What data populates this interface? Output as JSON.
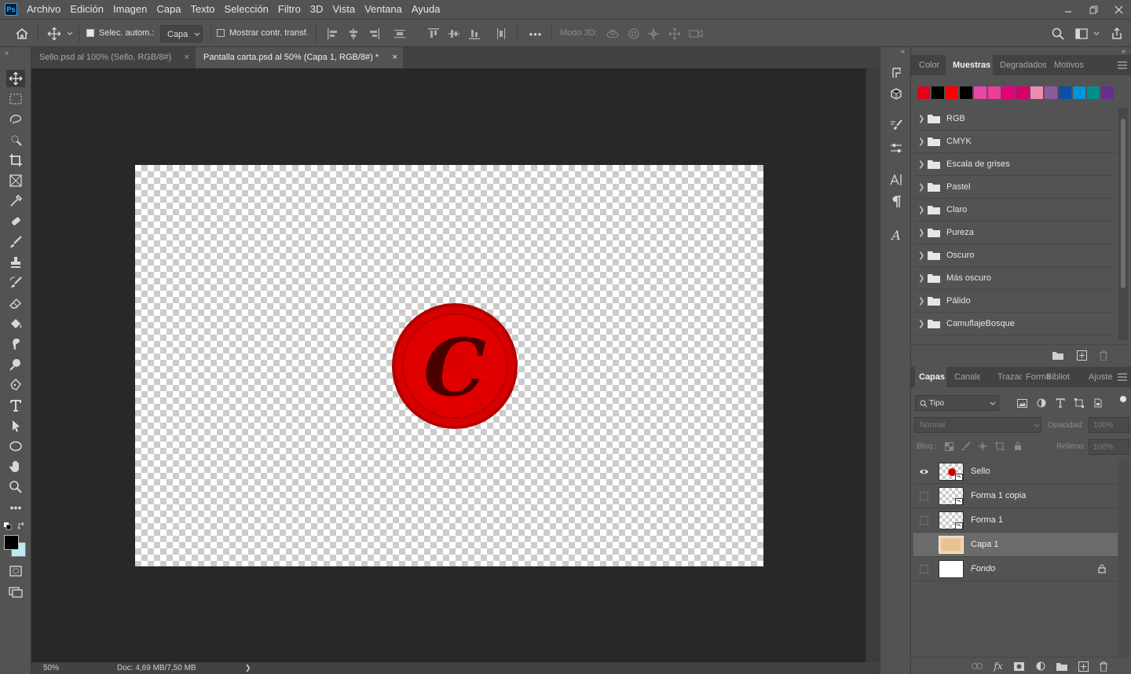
{
  "app": {
    "logo": "Ps"
  },
  "menu": [
    "Archivo",
    "Edición",
    "Imagen",
    "Capa",
    "Texto",
    "Selección",
    "Filtro",
    "3D",
    "Vista",
    "Ventana",
    "Ayuda"
  ],
  "window_controls": [
    "minimize-icon",
    "restore-icon",
    "close-icon"
  ],
  "options": {
    "auto_select_label": "Selec. autom.:",
    "auto_select_checked": true,
    "target_value": "Capa",
    "show_transform_label": "Mostrar contr. transf.",
    "show_transform_checked": false,
    "mode3d_label": "Modo 3D:",
    "more_label": "•••"
  },
  "tabs": [
    {
      "label": "Sello.psd al 100% (Sello, RGB/8#)",
      "active": false
    },
    {
      "label": "Pantalla carta.psd al 50% (Capa 1, RGB/8#) *",
      "active": true
    }
  ],
  "tab_close_glyph": "×",
  "status": {
    "zoom": "50%",
    "doc": "Doc: 4,69 MB/7,50 MB",
    "arrow": "❯"
  },
  "tools": [
    "move-tool-icon",
    "marquee-tool-icon",
    "lasso-tool-icon",
    "quick-select-tool-icon",
    "crop-tool-icon",
    "frame-tool-icon",
    "eyedropper-tool-icon",
    "healing-brush-tool-icon",
    "brush-tool-icon",
    "stamp-tool-icon",
    "history-brush-tool-icon",
    "eraser-tool-icon",
    "paint-bucket-tool-icon",
    "smudge-tool-icon",
    "dodge-tool-icon",
    "pen-tool-icon",
    "type-tool-icon",
    "path-select-tool-icon",
    "ellipse-tool-icon",
    "hand-tool-icon",
    "zoom-tool-icon",
    "more-tools-icon"
  ],
  "colors": {
    "foreground": "#000000",
    "background": "#bfe7ee"
  },
  "canvas": {
    "seal_letter": "C",
    "seal_color": "#d40000"
  },
  "swatch_panel": {
    "tabs": [
      "Color",
      "Muestras",
      "Degradados",
      "Motivos"
    ],
    "active_tab": "Muestras",
    "recent_swatches": [
      "#e5001c",
      "#000000",
      "#ff0000",
      "#000000",
      "#e946a9",
      "#ee3d98",
      "#e6007e",
      "#d5006b",
      "#ee8bb3",
      "#8c5a9e",
      "#0b4ea2",
      "#0094d9",
      "#008e8d",
      "#6b2c91"
    ],
    "groups": [
      "RGB",
      "CMYK",
      "Escala de grises",
      "Pastel",
      "Claro",
      "Pureza",
      "Oscuro",
      "Más oscuro",
      "Pálido",
      "CamuflajeBosque"
    ]
  },
  "layers_panel": {
    "tabs": [
      "Capas",
      "Canale",
      "Trazad",
      "Forma",
      "Bibliot",
      "Ajuste"
    ],
    "active_tab": "Capas",
    "filter_kind": "Tipo",
    "blend_mode": "Normal",
    "opacity_label": "Opacidad:",
    "opacity_value": "100%",
    "lock_label": "Bloq.:",
    "fill_label": "Relleno:",
    "fill_value": "100%",
    "layers": [
      {
        "name": "Sello",
        "visible": true,
        "selected": false,
        "italic": false,
        "smart": true
      },
      {
        "name": "Forma 1 copia",
        "visible": false,
        "selected": false,
        "italic": false,
        "smart": true
      },
      {
        "name": "Forma 1",
        "visible": false,
        "selected": false,
        "italic": false,
        "smart": true
      },
      {
        "name": "Capa 1",
        "visible": false,
        "selected": true,
        "italic": false,
        "smart": false
      },
      {
        "name": "Fondo",
        "visible": false,
        "selected": false,
        "italic": true,
        "locked": true
      }
    ]
  }
}
